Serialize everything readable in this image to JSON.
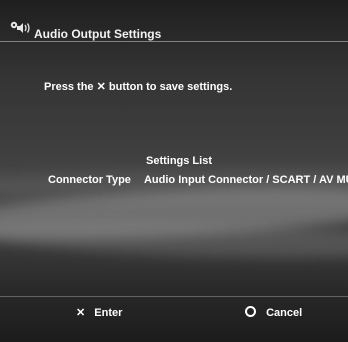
{
  "header": {
    "title": "Audio Output Settings",
    "icon": "speaker-settings-icon"
  },
  "instruction": {
    "prefix": "Press the",
    "button_glyph": "✕",
    "suffix": "button to save settings."
  },
  "settings_list": {
    "heading": "Settings List",
    "rows": [
      {
        "label": "Connector Type",
        "value": "Audio Input Connector / SCART / AV MULTI"
      }
    ]
  },
  "footer": {
    "enter": {
      "glyph": "✕",
      "label": "Enter"
    },
    "cancel": {
      "glyph": "circle-icon",
      "label": "Cancel"
    }
  },
  "colors": {
    "text": "#ffffff",
    "background_dark": "#1f1f1f",
    "background_mid": "#4b4b4b"
  }
}
